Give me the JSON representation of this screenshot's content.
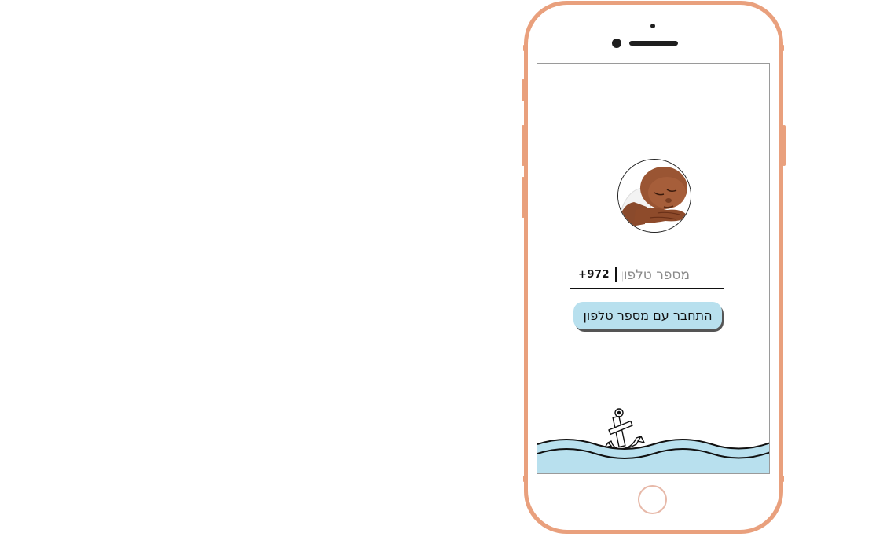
{
  "login": {
    "country_code": "+972",
    "phone_placeholder": "מספר טלפון",
    "phone_value": "",
    "connect_button_label": "התחבר עם מספר טלפון"
  },
  "icons": {
    "avatar": "sleeping-baby-photo",
    "decoration": "anchor-icon"
  },
  "colors": {
    "phone_frame": "#e9a07d",
    "button_bg": "#b8e0ee",
    "water": "#b8e0ee",
    "home_ring": "#e7b9a9"
  }
}
